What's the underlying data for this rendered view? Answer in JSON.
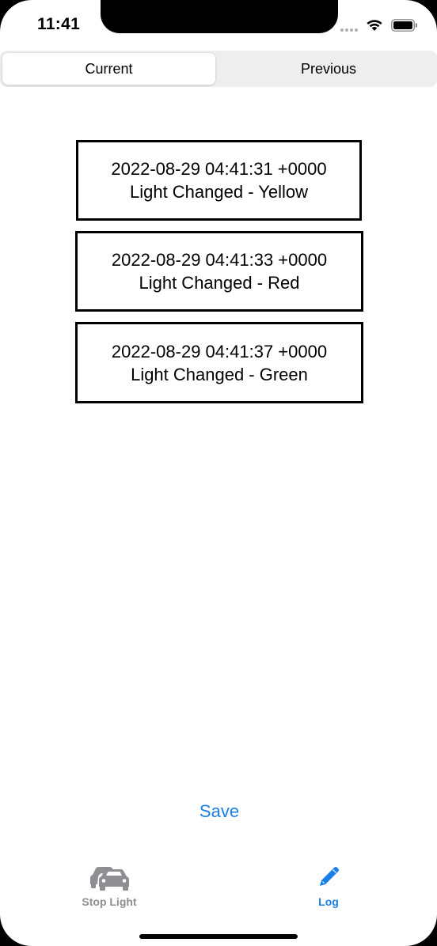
{
  "status_bar": {
    "time": "11:41"
  },
  "segmented_control": {
    "current_label": "Current",
    "previous_label": "Previous",
    "selected": "Current"
  },
  "log_entries": [
    {
      "timestamp": "2022-08-29 04:41:31 +0000",
      "message": "Light Changed - Yellow"
    },
    {
      "timestamp": "2022-08-29 04:41:33 +0000",
      "message": "Light Changed - Red"
    },
    {
      "timestamp": "2022-08-29 04:41:37 +0000",
      "message": "Light Changed - Green"
    }
  ],
  "save_label": "Save",
  "tab_bar": {
    "items": [
      {
        "label": "Stop Light",
        "icon": "cars-icon",
        "selected": false
      },
      {
        "label": "Log",
        "icon": "pencil-icon",
        "selected": true
      }
    ]
  },
  "colors": {
    "accent": "#1a7fe6",
    "inactive": "#8e8e93",
    "segment_background": "#eeeeef"
  }
}
